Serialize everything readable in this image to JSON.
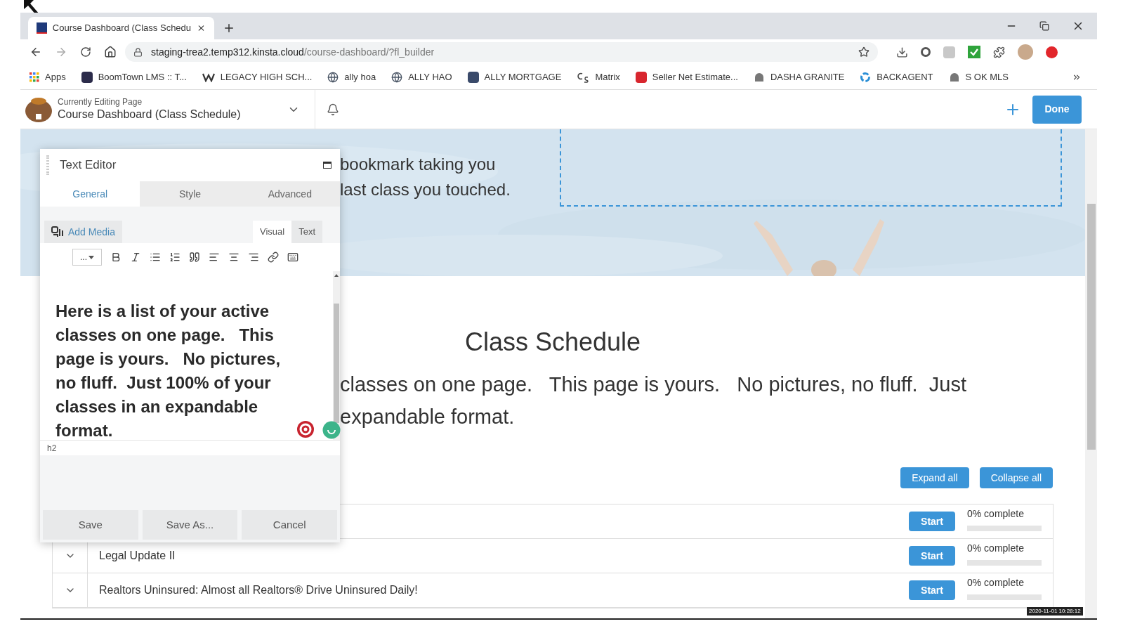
{
  "browser": {
    "tab": {
      "title": "Course Dashboard (Class Schedu"
    },
    "url_host": "staging-trea2.temp312.kinsta.cloud",
    "url_path": "/course-dashboard/?fl_builder",
    "bookmarks": [
      {
        "label": "Apps",
        "kind": "apps"
      },
      {
        "label": "BoomTown LMS :: T...",
        "kind": "square",
        "color": "#2b2b4a"
      },
      {
        "label": "LEGACY HIGH SCH...",
        "kind": "w"
      },
      {
        "label": "ally hoa",
        "kind": "globe"
      },
      {
        "label": "ALLY HAO",
        "kind": "globe"
      },
      {
        "label": "ALLY MORTGAGE",
        "kind": "square",
        "color": "#3a4a6a"
      },
      {
        "label": "Matrix",
        "kind": "cs"
      },
      {
        "label": "Seller Net Estimate...",
        "kind": "square",
        "color": "#d8262e"
      },
      {
        "label": "DASHA GRANITE",
        "kind": "dome"
      },
      {
        "label": "BACKAGENT",
        "kind": "ring"
      },
      {
        "label": "S OK MLS",
        "kind": "dome"
      }
    ]
  },
  "builder_bar": {
    "caption": "Currently Editing Page",
    "page_title": "Course Dashboard (Class Schedule)",
    "done": "Done"
  },
  "hero": {
    "lines": [
      "bookmark taking you",
      "last class you touched."
    ]
  },
  "editor": {
    "title": "Text Editor",
    "tabs": [
      {
        "label": "General",
        "selected": true
      },
      {
        "label": "Style",
        "selected": false
      },
      {
        "label": "Advanced",
        "selected": false
      }
    ],
    "add_media": "Add Media",
    "modes": [
      {
        "label": "Visual",
        "selected": true
      },
      {
        "label": "Text",
        "selected": false
      }
    ],
    "format_select": "...",
    "content": "Here is a list of your active classes on one page.   This page is yours.   No pictures, no fluff.  Just 100% of your classes in an expandable format.",
    "path": "h2",
    "buttons": [
      "Save",
      "Save As...",
      "Cancel"
    ]
  },
  "schedule": {
    "title": "Class Schedule",
    "lines": [
      "classes on one page.   This page is yours.   No pictures, no fluff.  Just",
      "expandable format."
    ],
    "expand": "Expand all",
    "collapse": "Collapse all",
    "rows": [
      {
        "start": "Start",
        "progress": "0% complete",
        "level": 0
      },
      {
        "title": "Legal Update II",
        "start": "Start",
        "progress": "0% complete",
        "level": 0
      },
      {
        "title": "Realtors Uninsured: Almost all Realtors® Drive Uninsured Daily!",
        "start": "Start",
        "progress": "0% complete",
        "level": 0
      }
    ]
  },
  "timestamp": "2020-11-01 10:28:12"
}
